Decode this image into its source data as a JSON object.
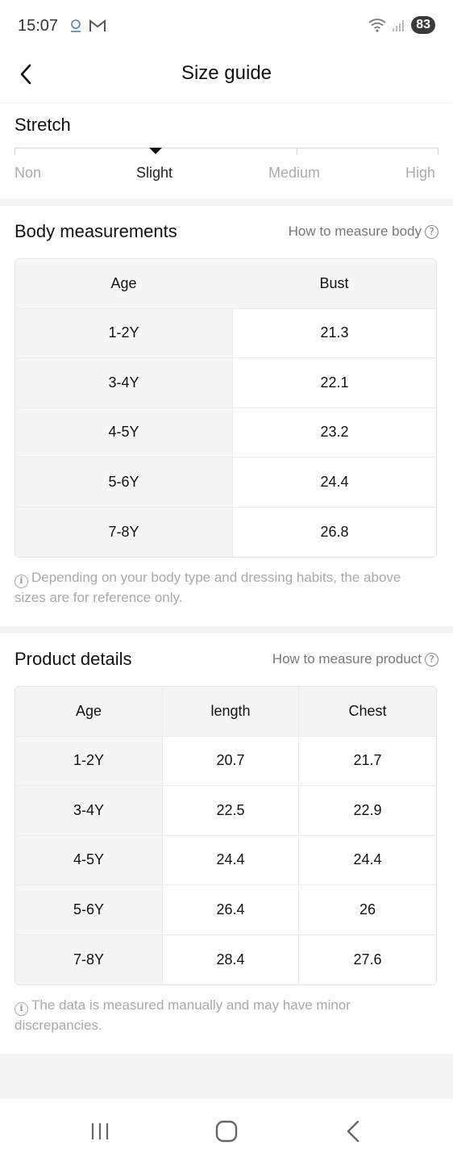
{
  "status": {
    "time": "15:07",
    "battery": "83"
  },
  "header": {
    "title": "Size guide"
  },
  "stretch": {
    "title": "Stretch",
    "levels": [
      "Non",
      "Slight",
      "Medium",
      "High"
    ],
    "selected": "Slight"
  },
  "body_measurements": {
    "title": "Body measurements",
    "link": "How to measure body",
    "columns": [
      "Age",
      "Bust"
    ],
    "rows": [
      [
        "1-2Y",
        "21.3"
      ],
      [
        "3-4Y",
        "22.1"
      ],
      [
        "4-5Y",
        "23.2"
      ],
      [
        "5-6Y",
        "24.4"
      ],
      [
        "7-8Y",
        "26.8"
      ]
    ],
    "note": "Depending on your body type and dressing habits, the above sizes are for reference only."
  },
  "product_details": {
    "title": "Product details",
    "link": "How to measure product",
    "columns": [
      "Age",
      "length",
      "Chest"
    ],
    "rows": [
      [
        "1-2Y",
        "20.7",
        "21.7"
      ],
      [
        "3-4Y",
        "22.5",
        "22.9"
      ],
      [
        "4-5Y",
        "24.4",
        "24.4"
      ],
      [
        "5-6Y",
        "26.4",
        "26"
      ],
      [
        "7-8Y",
        "28.4",
        "27.6"
      ]
    ],
    "note": "The data is measured manually and may have minor discrepancies."
  },
  "icons": {
    "back": "chevron-left-icon",
    "help": "question-circle-icon",
    "info": "info-circle-icon",
    "nav_recent": "recent-apps-icon",
    "nav_home": "home-icon",
    "nav_back": "back-icon"
  }
}
